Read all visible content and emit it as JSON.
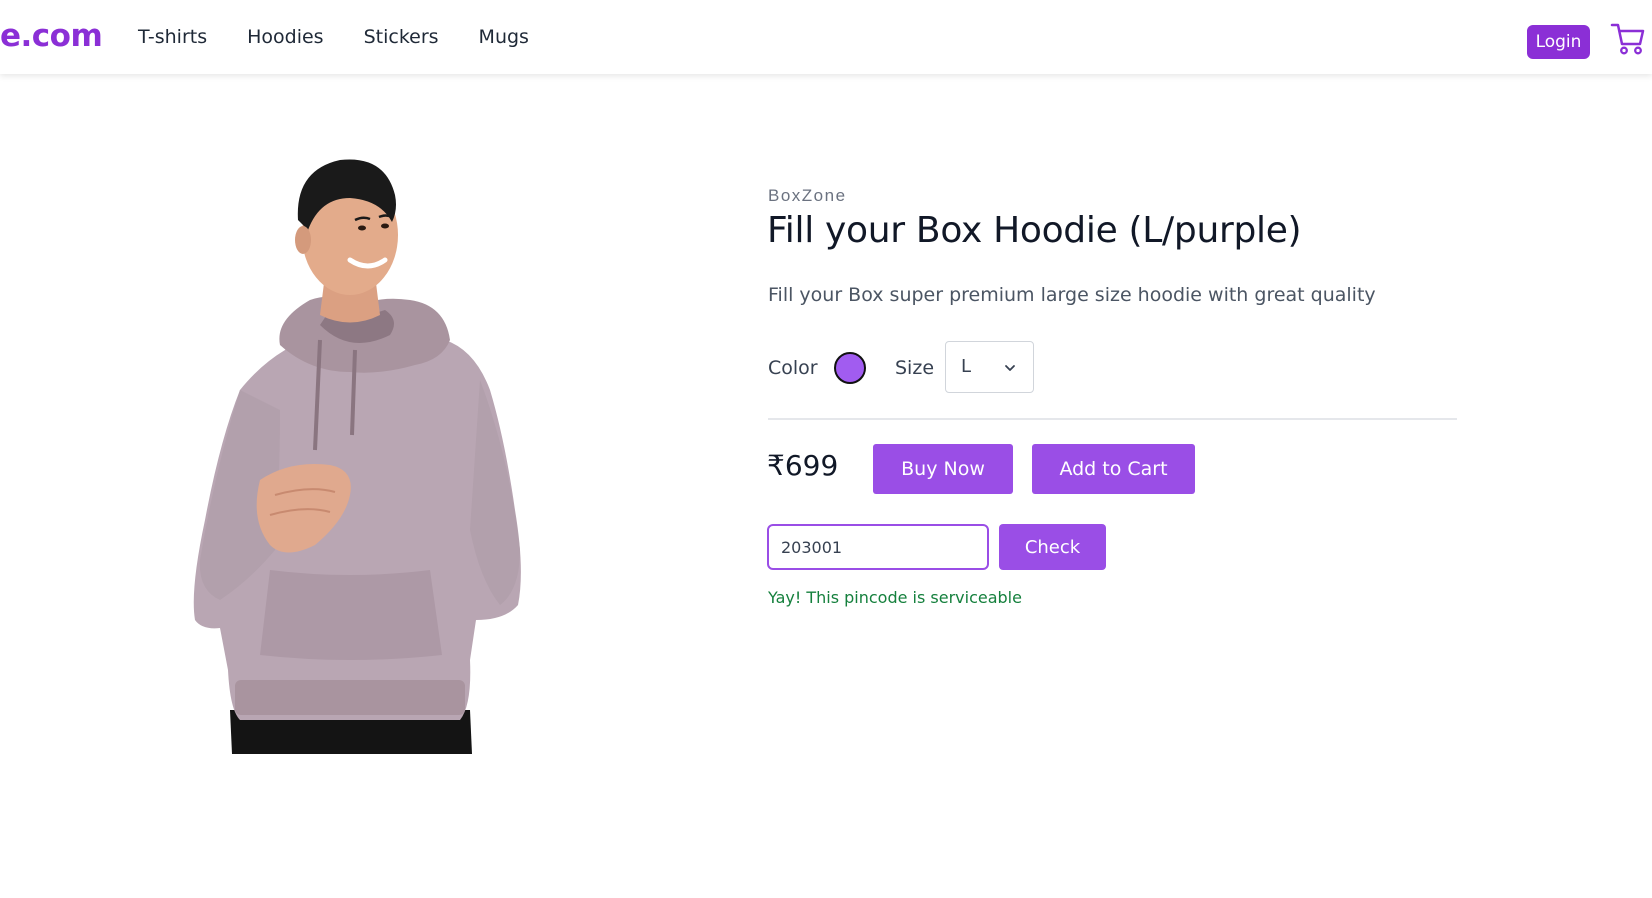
{
  "header": {
    "logo_text": "e.com",
    "nav": [
      "T-shirts",
      "Hoodies",
      "Stickers",
      "Mugs"
    ],
    "login_label": "Login",
    "cart_icon": "cart-icon"
  },
  "product": {
    "brand": "BoxZone",
    "title": "Fill your Box Hoodie (L/purple)",
    "description": "Fill your Box super premium large size hoodie with great quality",
    "color_label": "Color",
    "selected_color": "#a15cf0",
    "size_label": "Size",
    "selected_size": "L",
    "price": "₹699",
    "buy_now_label": "Buy Now",
    "add_to_cart_label": "Add to Cart"
  },
  "pincode": {
    "value": "203001",
    "check_label": "Check",
    "message": "Yay! This pincode is serviceable"
  },
  "colors": {
    "accent": "#9a4ee6",
    "logo": "#8b2fd6",
    "success": "#15803d"
  }
}
